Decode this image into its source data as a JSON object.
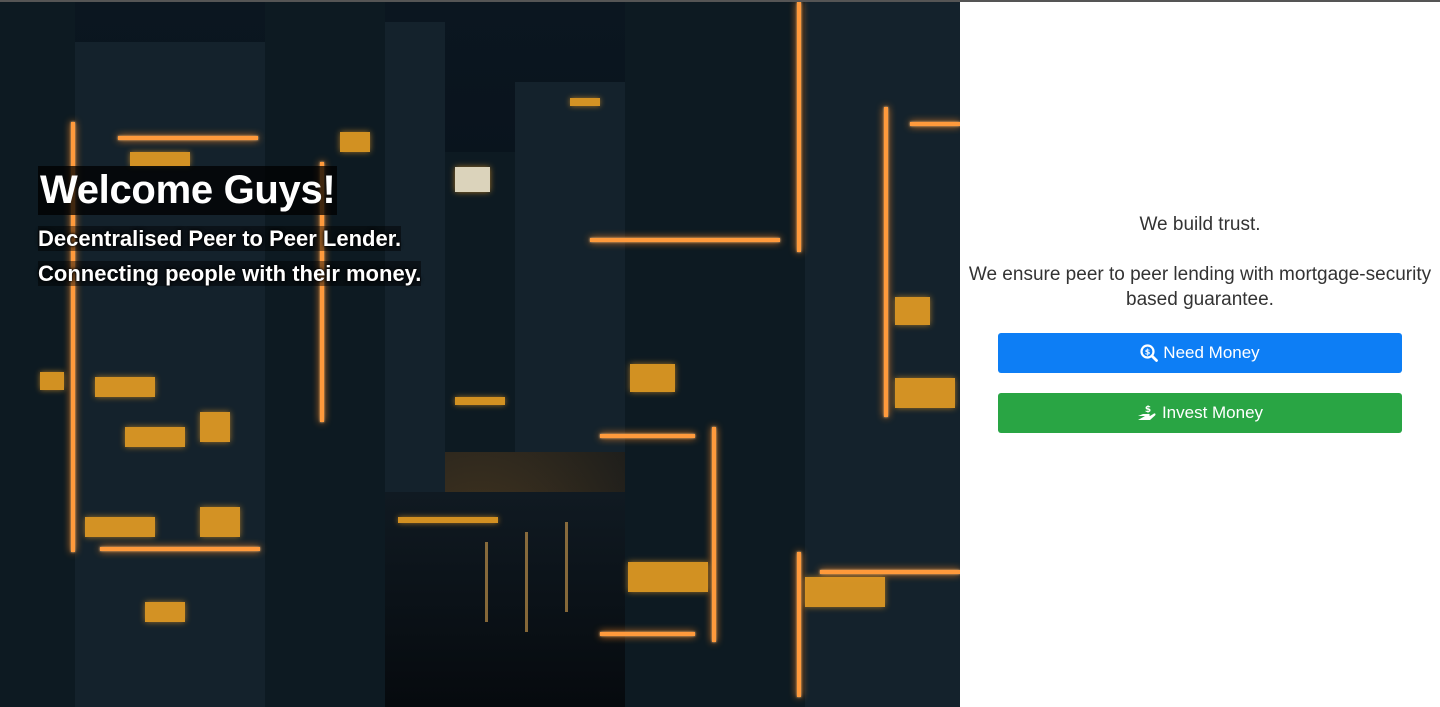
{
  "hero": {
    "title": "Welcome Guys!",
    "subtitle_line1": "Decentralised Peer to Peer Lender.",
    "subtitle_line2": "Connecting people with their money."
  },
  "panel": {
    "tagline": "We build trust.",
    "description": "We ensure peer to peer lending with mortgage-security based guarantee.",
    "need_money_label": "Need Money",
    "need_money_icon": "search-dollar-icon",
    "invest_money_label": "Invest Money",
    "invest_money_icon": "hand-holding-usd-icon"
  },
  "colors": {
    "need_money": "#0d7ef5",
    "invest_money": "#29a544",
    "neon_accent": "#ff9a3c"
  }
}
